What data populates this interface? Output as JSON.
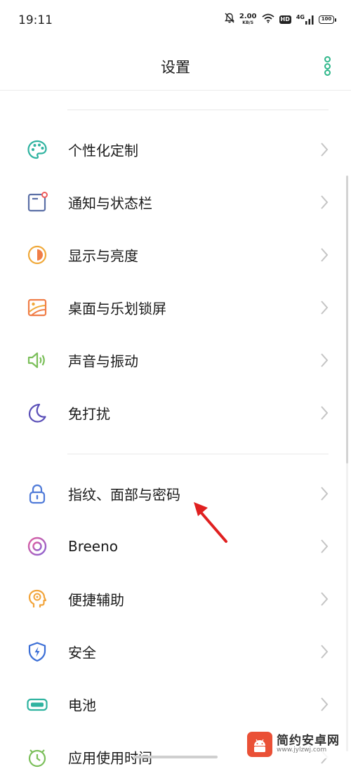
{
  "status_bar": {
    "time": "19:11",
    "net_speed": "2.00",
    "net_speed_unit": "KB/S",
    "hd_label": "HD",
    "network_type": "4G",
    "battery_level": "100"
  },
  "header": {
    "title": "设置"
  },
  "settings": [
    {
      "label": "个性化定制",
      "icon": "palette-icon",
      "color": "#2fb3a0"
    },
    {
      "label": "通知与状态栏",
      "icon": "notification-icon",
      "color": "#5b6fa6"
    },
    {
      "label": "显示与亮度",
      "icon": "brightness-icon",
      "color": "#f0a93a"
    },
    {
      "label": "桌面与乐划锁屏",
      "icon": "wallpaper-icon",
      "color": "#f07d47"
    },
    {
      "label": "声音与振动",
      "icon": "speaker-icon",
      "color": "#7bbf5a"
    },
    {
      "label": "免打扰",
      "icon": "moon-icon",
      "color": "#5a4fb8"
    },
    {
      "label": "指纹、面部与密码",
      "icon": "lock-icon",
      "color": "#4f7ad8"
    },
    {
      "label": "Breeno",
      "icon": "breeno-icon",
      "color": "#c76bcf"
    },
    {
      "label": "便捷辅助",
      "icon": "assist-head-icon",
      "color": "#f2a43a"
    },
    {
      "label": "安全",
      "icon": "shield-icon",
      "color": "#3b6ed6"
    },
    {
      "label": "电池",
      "icon": "battery-icon",
      "color": "#2fb3a0"
    },
    {
      "label": "应用使用时间",
      "icon": "clock-icon",
      "color": "#7bbf5a"
    }
  ],
  "watermark": {
    "name": "简约安卓网",
    "url": "www.jylzwj.com"
  },
  "colors": {
    "accent": "#2fb78a",
    "annotation_arrow": "#e02020"
  }
}
